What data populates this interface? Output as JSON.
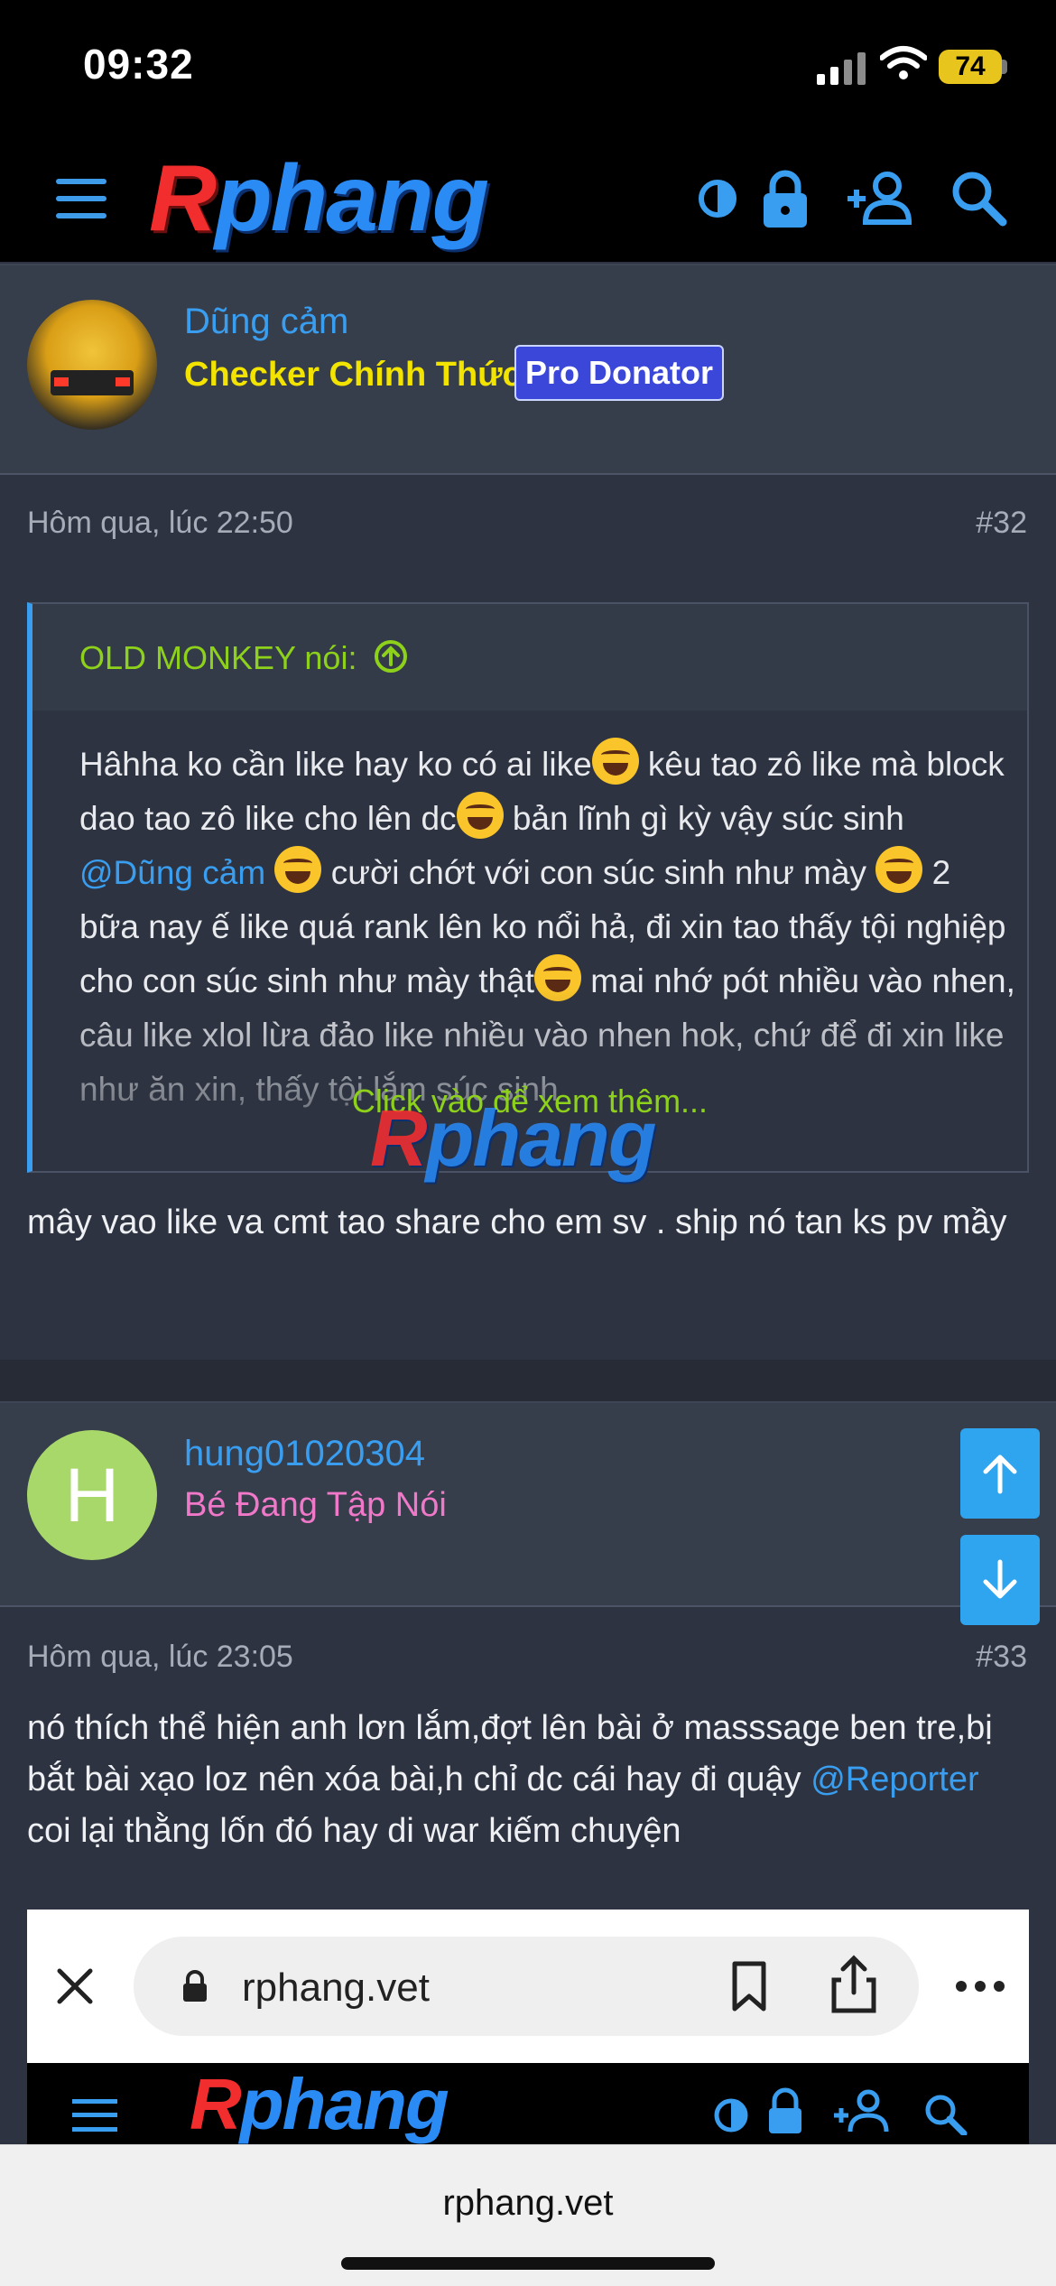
{
  "status": {
    "time": "09:32",
    "battery": "74"
  },
  "site": {
    "logo": "Rphang"
  },
  "post1": {
    "username": "Dũng cảm",
    "user_title": "Checker Chính Thức",
    "badge": "Pro Donator",
    "date": "Hôm qua, lúc 22:50",
    "number": "#32",
    "quote": {
      "author": "OLD MONKEY nói:",
      "segments": [
        "Hâhha ko cần like hay ko có ai like",
        " kêu tao zô like mà block dao tao zô like cho lên dc",
        " bản lĩnh gì kỳ vậy súc sinh ",
        "@Dũng cảm",
        " cười chớt với con súc sinh như mày ",
        " 2 bữa nay ế like quá rank lên ko nổi hả, đi xin tao thấy tội nghiệp cho con súc sinh như mày thật",
        " mai nhớ pót nhiều vào nhen, câu like xlol lừa đảo like nhiều vào nhen hok, chứ để đi xin like như ăn xin, thấy tội lắm súc sinh"
      ],
      "expand_label": "Click vào để xem thêm..."
    },
    "content": "mây vao like va cmt tao share cho em sv . ship nó tan ks pv mầy"
  },
  "post2": {
    "username": "hung01020304",
    "avatar_letter": "H",
    "user_title": "Bé Đang Tập Nói",
    "date": "Hôm qua, lúc 23:05",
    "number": "#33",
    "content_before": "nó thích thể hiện anh lơn lắm,đợt lên bài ở masssage ben tre,bị bắt bài xạo loz nên xóa bài,h chỉ dc cái hay đi quậy ",
    "mention": "@Reporter",
    "content_after": " coi lại thằng lốn đó hay di war kiếm chuyện",
    "embed_url": "rphang.vet"
  },
  "browser": {
    "url": "rphang.vet"
  },
  "colors": {
    "accent": "#3a9ef0",
    "lime": "#8ed11b",
    "yellow": "#f2e400",
    "pink": "#f078c8",
    "badge": "#3b47d9"
  }
}
